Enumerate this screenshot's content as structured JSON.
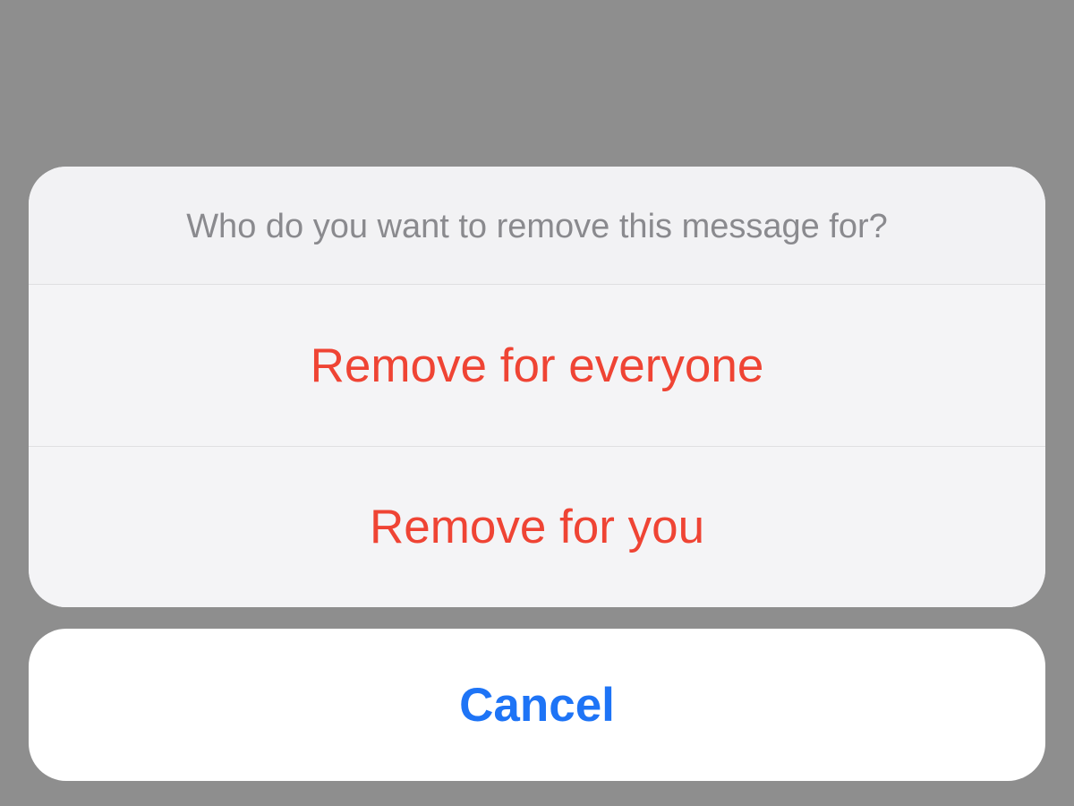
{
  "action_sheet": {
    "title": "Who do you want to remove this message for?",
    "options": [
      {
        "label": "Remove for everyone"
      },
      {
        "label": "Remove for you"
      }
    ],
    "cancel_label": "Cancel"
  },
  "colors": {
    "background": "#8e8e8e",
    "sheet_bg": "#f2f2f4",
    "cancel_bg": "#ffffff",
    "title_text": "#8a8a8e",
    "destructive": "#ef4434",
    "cancel_text": "#1e74f6"
  }
}
